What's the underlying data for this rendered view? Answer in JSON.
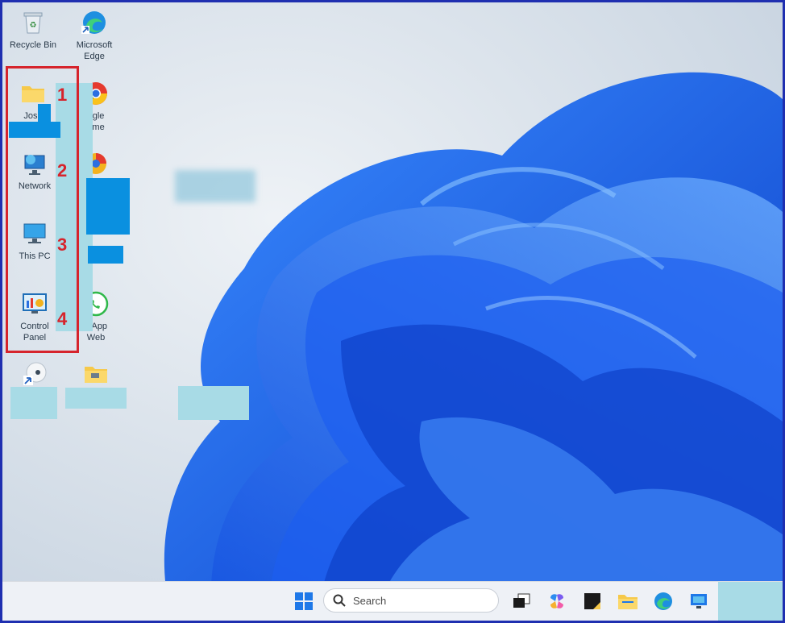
{
  "desktop": {
    "icons": [
      {
        "label": "Recycle Bin"
      },
      {
        "label": "Microsoft Edge"
      },
      {
        "label": "Jose"
      },
      {
        "label": "Google Chrome"
      },
      {
        "label": "Network"
      },
      {
        "label": "This PC"
      },
      {
        "label": "Control Panel"
      },
      {
        "label": "WhatsApp Web"
      }
    ],
    "labels_partial": {
      "chrome_line1": "ogle",
      "chrome_line2": "ome",
      "whatsapp_line1": "tsApp",
      "whatsapp_line2": "Web"
    }
  },
  "annotation": {
    "numbers": [
      "1",
      "2",
      "3",
      "4"
    ],
    "color": "#d6242c"
  },
  "taskbar": {
    "search_placeholder": "Search"
  },
  "colors": {
    "accent": "#1e6fe8",
    "frame": "#1f2fb0",
    "mask": "#a8dbe6",
    "mask_dark": "#0a90e0"
  }
}
